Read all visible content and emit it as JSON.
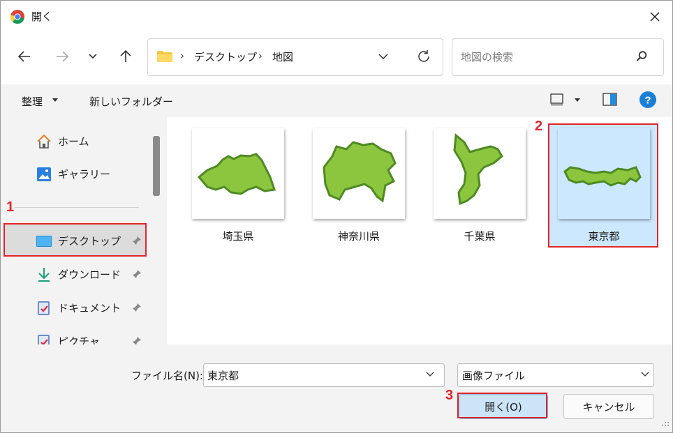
{
  "window": {
    "title": "開く",
    "app_icon": "chrome-icon",
    "close_icon": "close-icon"
  },
  "nav": {
    "back_icon": "back-arrow-icon",
    "forward_icon": "forward-arrow-icon",
    "recent_icon": "chevron-down-icon",
    "up_icon": "up-arrow-icon",
    "breadcrumb": [
      "デスクトップ",
      "地図"
    ],
    "refresh_icon": "refresh-icon",
    "search_placeholder": "地図の検索"
  },
  "toolbar": {
    "organize": "整理",
    "new_folder": "新しいフォルダー"
  },
  "sidebar": {
    "items": [
      {
        "label": "ホーム",
        "icon": "home-icon"
      },
      {
        "label": "ギャラリー",
        "icon": "gallery-icon"
      },
      {
        "label": "デスクトップ",
        "icon": "desktop-icon",
        "selected": true,
        "pinned": true
      },
      {
        "label": "ダウンロード",
        "icon": "download-icon",
        "pinned": true
      },
      {
        "label": "ドキュメント",
        "icon": "documents-icon",
        "pinned": true
      },
      {
        "label": "ピクチャ",
        "icon": "pictures-icon",
        "pinned": true
      }
    ]
  },
  "files": [
    {
      "name": "埼玉県",
      "selected": false
    },
    {
      "name": "神奈川県",
      "selected": false
    },
    {
      "name": "千葉県",
      "selected": false
    },
    {
      "name": "東京都",
      "selected": true
    }
  ],
  "footer": {
    "filename_label": "ファイル名(N):",
    "filename_value": "東京都",
    "filetype_value": "画像ファイル",
    "open_button": "開く(O)",
    "cancel_button": "キャンセル"
  },
  "annotations": [
    "1",
    "2",
    "3"
  ],
  "colors": {
    "highlight": "#e3242b",
    "selection": "#cce8ff",
    "map_fill": "#8cc63f",
    "map_edge": "#4e8a22"
  }
}
